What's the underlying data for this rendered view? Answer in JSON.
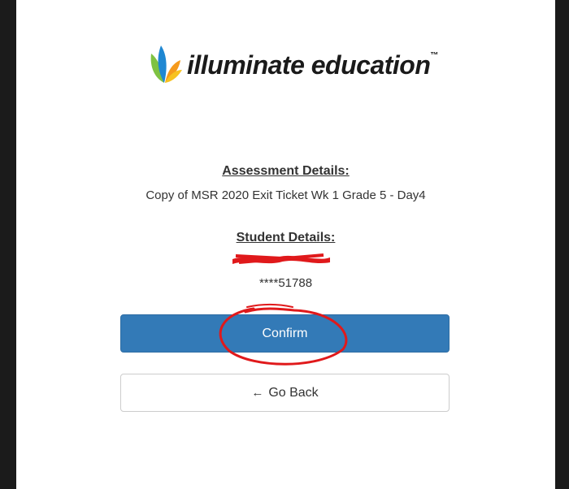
{
  "logo": {
    "text": "illuminate education",
    "tm": "™"
  },
  "assessment": {
    "heading": "Assessment Details:",
    "name": "Copy of MSR 2020 Exit Ticket Wk 1 Grade 5 - Day4"
  },
  "student": {
    "heading": "Student Details:",
    "id": "****51788"
  },
  "buttons": {
    "confirm_label": "Confirm",
    "back_label": "Go Back",
    "back_icon": "←"
  },
  "colors": {
    "primary": "#337ab7",
    "annotation": "#e0191b"
  }
}
